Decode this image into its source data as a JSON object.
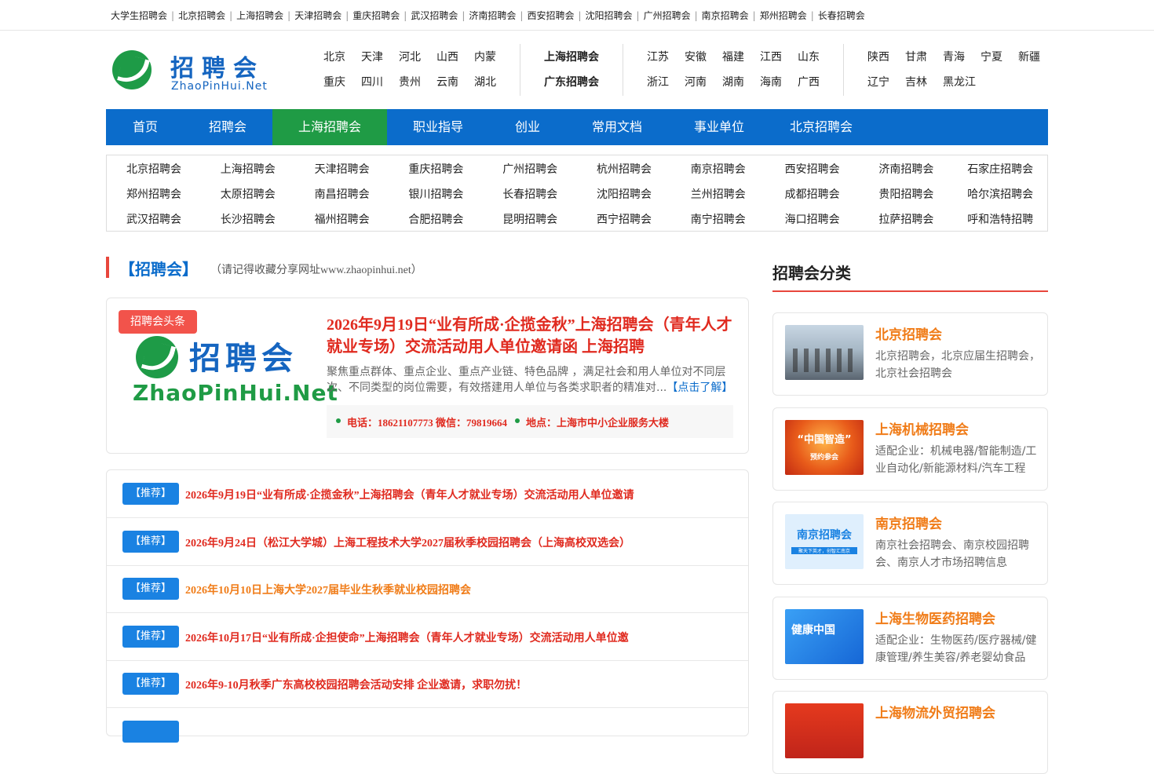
{
  "topbar": {
    "links": [
      "大学生招聘会",
      "北京招聘会",
      "上海招聘会",
      "天津招聘会",
      "重庆招聘会",
      "武汉招聘会",
      "济南招聘会",
      "西安招聘会",
      "沈阳招聘会",
      "广州招聘会",
      "南京招聘会",
      "郑州招聘会",
      "长春招聘会"
    ]
  },
  "logo": {
    "cn": "招聘会",
    "en": "ZhaoPinHui.Net"
  },
  "provinces": {
    "g1_row1": [
      "北京",
      "天津",
      "河北",
      "山西",
      "内蒙"
    ],
    "g1_row2": [
      "重庆",
      "四川",
      "贵州",
      "云南",
      "湖北"
    ],
    "g2_row1": [
      "上海招聘会"
    ],
    "g2_row2": [
      "广东招聘会"
    ],
    "g3_row1": [
      "江苏",
      "安徽",
      "福建",
      "江西",
      "山东"
    ],
    "g3_row2": [
      "浙江",
      "河南",
      "湖南",
      "海南",
      "广西"
    ],
    "g4_row1": [
      "陕西",
      "甘肃",
      "青海",
      "宁夏",
      "新疆"
    ],
    "g4_row2": [
      "辽宁",
      "吉林",
      "黑龙江"
    ]
  },
  "nav": {
    "items": [
      "首页",
      "招聘会",
      "上海招聘会",
      "职业指导",
      "创业",
      "常用文档",
      "事业单位",
      "北京招聘会"
    ],
    "active": "上海招聘会"
  },
  "cities": [
    [
      "北京招聘会",
      "上海招聘会",
      "天津招聘会",
      "重庆招聘会",
      "广州招聘会",
      "杭州招聘会",
      "南京招聘会",
      "西安招聘会",
      "济南招聘会",
      "石家庄招聘会"
    ],
    [
      "郑州招聘会",
      "太原招聘会",
      "南昌招聘会",
      "银川招聘会",
      "长春招聘会",
      "沈阳招聘会",
      "兰州招聘会",
      "成都招聘会",
      "贵阳招聘会",
      "哈尔滨招聘会"
    ],
    [
      "武汉招聘会",
      "长沙招聘会",
      "福州招聘会",
      "合肥招聘会",
      "昆明招聘会",
      "西宁招聘会",
      "南宁招聘会",
      "海口招聘会",
      "拉萨招聘会",
      "呼和浩特招聘"
    ]
  ],
  "section": {
    "title": "【招聘会】",
    "note": "（请记得收藏分享网址www.zhaopinhui.net）"
  },
  "headline": {
    "badge": "招聘会头条",
    "logo_cn": "招聘会",
    "logo_en": "ZhaoPinHui.Net",
    "title": "2026年9月19日“业有所成·企揽金秋”上海招聘会（青年人才就业专场）交流活动用人单位邀请函 上海招聘",
    "desc": "聚焦重点群体、重点企业、重点产业链、特色品牌 ，满足社会和用人单位对不同层次、不同类型的岗位需要，有效搭建用人单位与各类求职者的精准对...",
    "more": "【点击了解】",
    "phone": "电话：18621107773 微信：79819664",
    "address": "地点：上海市中小企业服务大楼"
  },
  "recommend": {
    "tag": "【推荐】",
    "items": [
      {
        "text": "2026年9月19日“业有所成·企揽金秋”上海招聘会（青年人才就业专场）交流活动用人单位邀请",
        "color": "#e02a1f"
      },
      {
        "text": "2026年9月24日（松江大学城）上海工程技术大学2027届秋季校园招聘会（上海高校双选会）",
        "color": "#e02a1f"
      },
      {
        "text": "2026年10月10日上海大学2027届毕业生秋季就业校园招聘会",
        "color": "#f07c18"
      },
      {
        "text": "2026年10月17日“业有所成·企担使命”上海招聘会（青年人才就业专场）交流活动用人单位邀",
        "color": "#e02a1f"
      },
      {
        "text": "2026年9-10月秋季广东高校校园招聘会活动安排 企业邀请，求职勿扰！",
        "color": "#e02a1f"
      }
    ]
  },
  "sidebar": {
    "title": "招聘会分类",
    "cards": [
      {
        "title": "北京招聘会",
        "desc": "北京招聘会，北京应届生招聘会，北京社会招聘会"
      },
      {
        "title": "上海机械招聘会",
        "desc": "适配企业：机械电器/智能制造/工业自动化/新能源材料/汽车工程",
        "thumb_text": "“中国智造”",
        "thumb_sub": "预约参会"
      },
      {
        "title": "南京招聘会",
        "desc": "南京社会招聘会、南京校园招聘会、南京人才市场招聘信息",
        "thumb_text": "南京招聘会",
        "thumb_sub": "聚天下英才，创智汇南京"
      },
      {
        "title": "上海生物医药招聘会",
        "desc": "适配企业：生物医药/医疗器械/健康管理/养生美容/养老婴幼食品",
        "thumb_text": "健康中国"
      },
      {
        "title": "上海物流外贸招聘会",
        "desc": ""
      }
    ]
  },
  "colors": {
    "brand_blue": "#0b6ccb",
    "nav_active_green": "#1f9b45",
    "headline_red": "#e02a1f",
    "sidebar_orange": "#f07c18"
  }
}
